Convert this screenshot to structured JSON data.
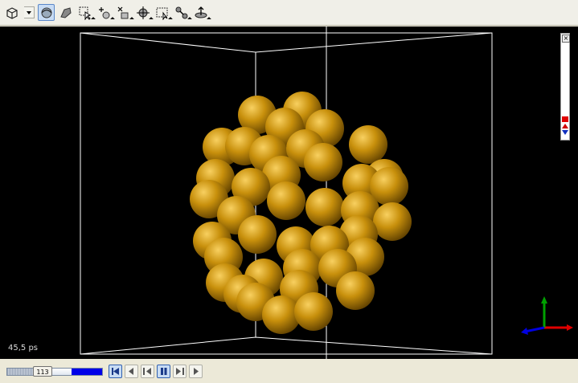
{
  "toolbar": {
    "tools": [
      {
        "name": "view-cube-icon",
        "dropdown": true
      },
      {
        "name": "rotate-icon",
        "active": true
      },
      {
        "name": "draw-icon"
      },
      {
        "name": "select-icon"
      },
      {
        "name": "add-atom-icon"
      },
      {
        "name": "delete-atom-icon"
      },
      {
        "name": "move-icon"
      },
      {
        "name": "box-select-icon"
      },
      {
        "name": "measure-icon"
      },
      {
        "name": "center-icon"
      }
    ]
  },
  "viewport": {
    "background": "#000000",
    "atom_color": "#c8900c",
    "timestamp": "45,5 ps"
  },
  "axes": {
    "x_color": "#0000e0",
    "y_color": "#00a000",
    "z_color": "#e00000"
  },
  "playback": {
    "frame": "113",
    "progress": 0.55,
    "controls": [
      {
        "name": "first-frame-icon",
        "active": true
      },
      {
        "name": "step-back-icon"
      },
      {
        "name": "play-backward-icon"
      },
      {
        "name": "pause-icon",
        "active": true
      },
      {
        "name": "play-forward-icon"
      },
      {
        "name": "step-forward-icon"
      }
    ]
  }
}
